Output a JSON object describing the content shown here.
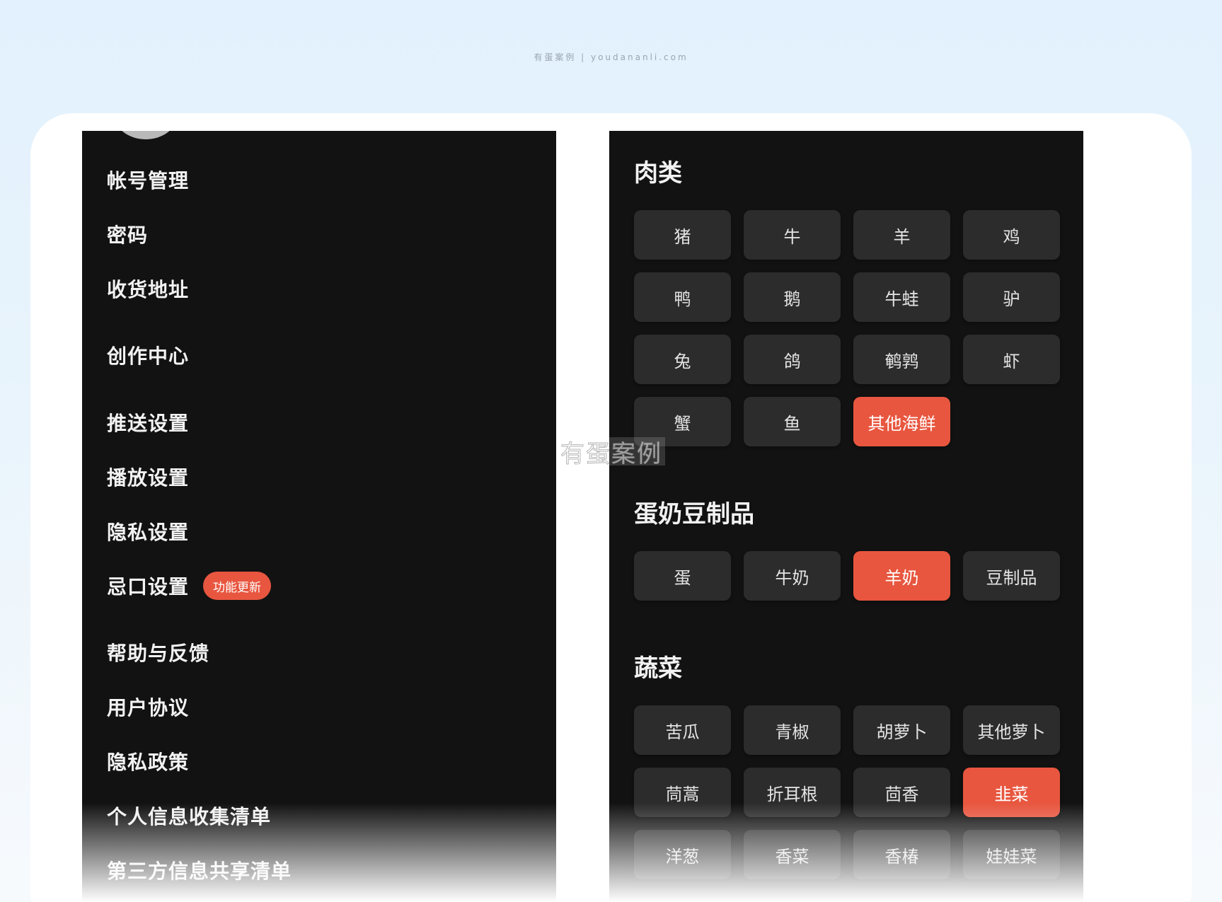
{
  "watermark": {
    "top_text": "有蛋案例 | youdananli.com",
    "center_text": "有蛋案例"
  },
  "colors": {
    "accent": "#e8563f",
    "panel_bg": "#121212",
    "chip_bg": "#2c2c2c"
  },
  "settings_menu": {
    "items": [
      {
        "label": "帐号管理"
      },
      {
        "label": "密码"
      },
      {
        "label": "收货地址"
      },
      {
        "label": "创作中心"
      },
      {
        "label": "推送设置"
      },
      {
        "label": "播放设置"
      },
      {
        "label": "隐私设置"
      },
      {
        "label": "忌口设置",
        "badge": "功能更新"
      },
      {
        "label": "帮助与反馈"
      },
      {
        "label": "用户协议"
      },
      {
        "label": "隐私政策"
      },
      {
        "label": "个人信息收集清单"
      },
      {
        "label": "第三方信息共享清单"
      }
    ]
  },
  "food_categories": {
    "sections": [
      {
        "title": "肉类",
        "items": [
          {
            "label": "猪",
            "selected": false
          },
          {
            "label": "牛",
            "selected": false
          },
          {
            "label": "羊",
            "selected": false
          },
          {
            "label": "鸡",
            "selected": false
          },
          {
            "label": "鸭",
            "selected": false
          },
          {
            "label": "鹅",
            "selected": false
          },
          {
            "label": "牛蛙",
            "selected": false
          },
          {
            "label": "驴",
            "selected": false
          },
          {
            "label": "兔",
            "selected": false
          },
          {
            "label": "鸽",
            "selected": false
          },
          {
            "label": "鹌鹑",
            "selected": false
          },
          {
            "label": "虾",
            "selected": false
          },
          {
            "label": "蟹",
            "selected": false
          },
          {
            "label": "鱼",
            "selected": false
          },
          {
            "label": "其他海鲜",
            "selected": true
          }
        ]
      },
      {
        "title": "蛋奶豆制品",
        "items": [
          {
            "label": "蛋",
            "selected": false
          },
          {
            "label": "牛奶",
            "selected": false
          },
          {
            "label": "羊奶",
            "selected": true
          },
          {
            "label": "豆制品",
            "selected": false
          }
        ]
      },
      {
        "title": "蔬菜",
        "items": [
          {
            "label": "苦瓜",
            "selected": false
          },
          {
            "label": "青椒",
            "selected": false
          },
          {
            "label": "胡萝卜",
            "selected": false
          },
          {
            "label": "其他萝卜",
            "selected": false
          },
          {
            "label": "茼蒿",
            "selected": false
          },
          {
            "label": "折耳根",
            "selected": false
          },
          {
            "label": "茴香",
            "selected": false
          },
          {
            "label": "韭菜",
            "selected": true
          },
          {
            "label": "洋葱",
            "selected": false
          },
          {
            "label": "香菜",
            "selected": false
          },
          {
            "label": "香椿",
            "selected": false
          },
          {
            "label": "娃娃菜",
            "selected": false
          }
        ]
      }
    ]
  }
}
